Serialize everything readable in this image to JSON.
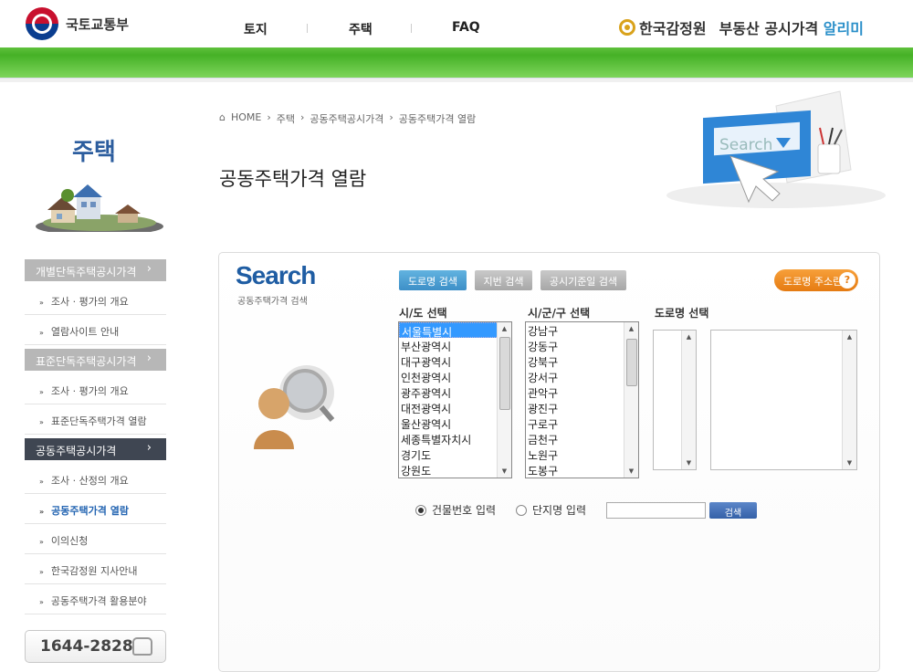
{
  "header": {
    "ministry": "국토교통부",
    "nav": [
      "토지",
      "주택",
      "FAQ"
    ],
    "agency": "한국감정원",
    "service_prefix": "부동산 공시가격 ",
    "service_highlight": "알리미"
  },
  "sidebar": {
    "title": "주택",
    "groups": [
      {
        "label": "개별단독주택공시가격",
        "items": [
          "조사 · 평가의 개요",
          "열람사이트 안내"
        ]
      },
      {
        "label": "표준단독주택공시가격",
        "items": [
          "조사 · 평가의 개요",
          "표준단독주택가격 열람"
        ]
      },
      {
        "label": "공동주택공시가격",
        "items": [
          "조사 · 산정의 개요",
          "공동주택가격 열람",
          "이의신청",
          "한국감정원 지사안내",
          "공동주택가격 활용분야"
        ]
      }
    ],
    "phone": "1644-2828"
  },
  "breadcrumb": [
    "HOME",
    "주택",
    "공동주택공시가격",
    "공동주택가격 열람"
  ],
  "page_title": "공동주택가격 열람",
  "illustration_text": "Search",
  "search": {
    "heading": "Search",
    "subheading": "공동주택가격 검색",
    "tabs": [
      "도로명 검색",
      "지번 검색",
      "공시기준일 검색"
    ],
    "road_address_button": "도로명 주소란",
    "help_glyph": "?",
    "sido_label": "시/도 선택",
    "sido_options": [
      "서울특별시",
      "부산광역시",
      "대구광역시",
      "인천광역시",
      "광주광역시",
      "대전광역시",
      "울산광역시",
      "세종특별자치시",
      "경기도",
      "강원도"
    ],
    "sido_selected": "서울특별시",
    "sigungu_label": "시/군/구 선택",
    "sigungu_options": [
      "강남구",
      "강동구",
      "강북구",
      "강서구",
      "관악구",
      "광진구",
      "구로구",
      "금천구",
      "노원구",
      "도봉구"
    ],
    "road_label": "도로명 선택",
    "radio_building": "건물번호 입력",
    "radio_complex": "단지명 입력",
    "radio_selected": "건물번호 입력",
    "input_value": "",
    "search_button": "검색"
  }
}
